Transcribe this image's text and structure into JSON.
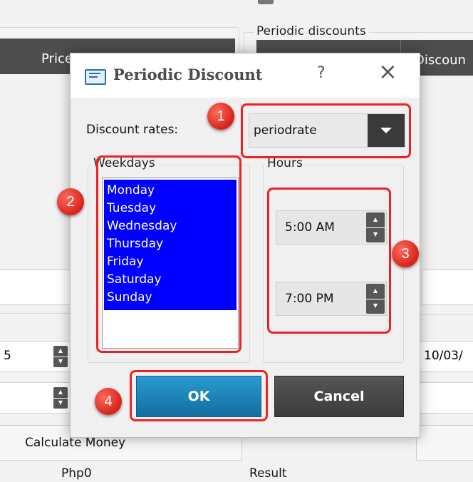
{
  "background": {
    "periodic_discounts_label": "Periodic discounts",
    "price_header": "Price",
    "discount_header": "Discoun",
    "left_number": "5",
    "date_value": "10/03/",
    "calculate_button_label": "Calculate Money",
    "amount_label": "Php0",
    "result_label": "Result"
  },
  "dialog": {
    "title": "Periodic Discount",
    "help_label": "?",
    "close_label": "×",
    "discount_rates_label": "Discount rates:",
    "discount_rate_value": "periodrate",
    "weekdays_label": "Weekdays",
    "weekdays": [
      "Monday",
      "Tuesday",
      "Wednesday",
      "Thursday",
      "Friday",
      "Saturday",
      "Sunday"
    ],
    "hours_label": "Hours",
    "start_time": "5:00 AM",
    "end_time": "7:00 PM",
    "ok_label": "OK",
    "cancel_label": "Cancel"
  },
  "annotations": {
    "badge_1": "1",
    "badge_2": "2",
    "badge_3": "3",
    "badge_4": "4"
  },
  "colors": {
    "selection_blue": "#0000ff",
    "ok_blue": "#1a86b8",
    "cancel_dark": "#4a4a4a",
    "annotation_red": "#e22222"
  }
}
